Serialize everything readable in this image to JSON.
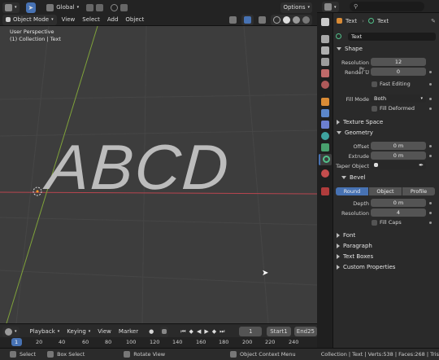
{
  "header": {
    "mode": "Object Mode",
    "menus": [
      "View",
      "Select",
      "Add",
      "Object"
    ],
    "transform": "Global",
    "options": "Options"
  },
  "viewport": {
    "perspective": "User Perspective",
    "collection": "(1) Collection | Text",
    "text_object": "ABCD"
  },
  "timeline": {
    "menus": [
      "Playback",
      "Keying",
      "View",
      "Marker"
    ],
    "current_frame": "1",
    "start_label": "Start",
    "start_value": "1",
    "end_label": "End",
    "end_value": "25",
    "ruler": [
      "1",
      "20",
      "40",
      "60",
      "80",
      "100",
      "120",
      "140",
      "160",
      "180",
      "200",
      "220",
      "240"
    ]
  },
  "status": {
    "select": "Select",
    "box_select": "Box Select",
    "rotate": "Rotate View",
    "context": "Object Context Menu",
    "stats": "Collection | Text | Verts:538 | Faces:268 | Tris"
  },
  "props": {
    "search_placeholder": "",
    "breadcrumb_obj": "Text",
    "breadcrumb_data": "Text",
    "datablock_name": "Text",
    "shape": {
      "title": "Shape",
      "resolution_preview_label": "Resolution Pr...",
      "resolution_preview": "12",
      "render_u_label": "Render U",
      "render_u": "0",
      "fast_editing": "Fast Editing",
      "fill_mode_label": "Fill Mode",
      "fill_mode": "Both",
      "fill_deformed": "Fill Deformed"
    },
    "texture_space": "Texture Space",
    "geometry": {
      "title": "Geometry",
      "offset_label": "Offset",
      "offset": "0 m",
      "extrude_label": "Extrude",
      "extrude": "0 m",
      "taper_label": "Taper Object"
    },
    "bevel": {
      "title": "Bevel",
      "tabs": [
        "Round",
        "Object",
        "Profile"
      ],
      "depth_label": "Depth",
      "depth": "0 m",
      "resolution_label": "Resolution",
      "resolution": "4",
      "fill_caps": "Fill Caps"
    },
    "collapsed": [
      "Font",
      "Paragraph",
      "Text Boxes",
      "Custom Properties"
    ]
  },
  "colors": {
    "accent": "#4772b3",
    "x_axis": "#b8454f",
    "y_axis": "#7fa23a"
  }
}
